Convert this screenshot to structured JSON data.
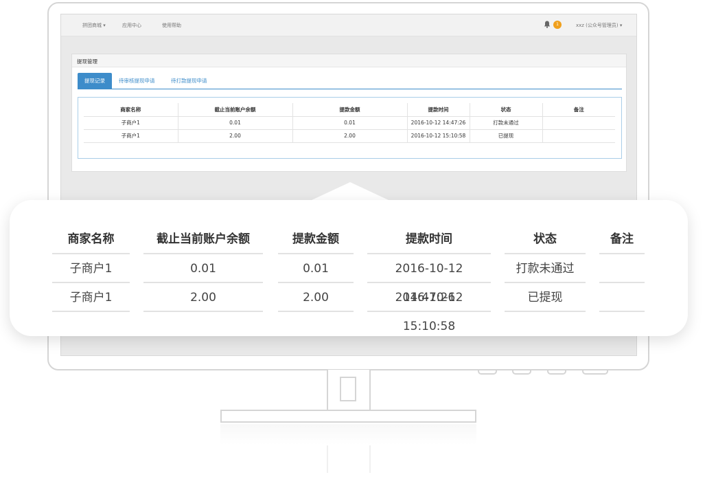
{
  "topbar": {
    "nav": [
      "拼团商城 ▾",
      "应用中心",
      "使用帮助"
    ],
    "notification_count": "1",
    "user": "xxz (公众号管理员) ▾"
  },
  "panel": {
    "title": "提现管理",
    "tabs": [
      "提现记录",
      "待审核提现申请",
      "待打款提现申请"
    ]
  },
  "table": {
    "headers": [
      "商家名称",
      "截止当前账户余额",
      "提款金额",
      "提款时间",
      "状态",
      "备注"
    ],
    "rows": [
      [
        "子商户1",
        "0.01",
        "0.01",
        "2016-10-12 14:47:26",
        "打款未通过",
        ""
      ],
      [
        "子商户1",
        "2.00",
        "2.00",
        "2016-10-12 15:10:58",
        "已提现",
        ""
      ]
    ]
  },
  "colors": {
    "accent": "#3d8cca",
    "badge": "#f0a01d"
  },
  "icons": [
    "bell-icon"
  ]
}
